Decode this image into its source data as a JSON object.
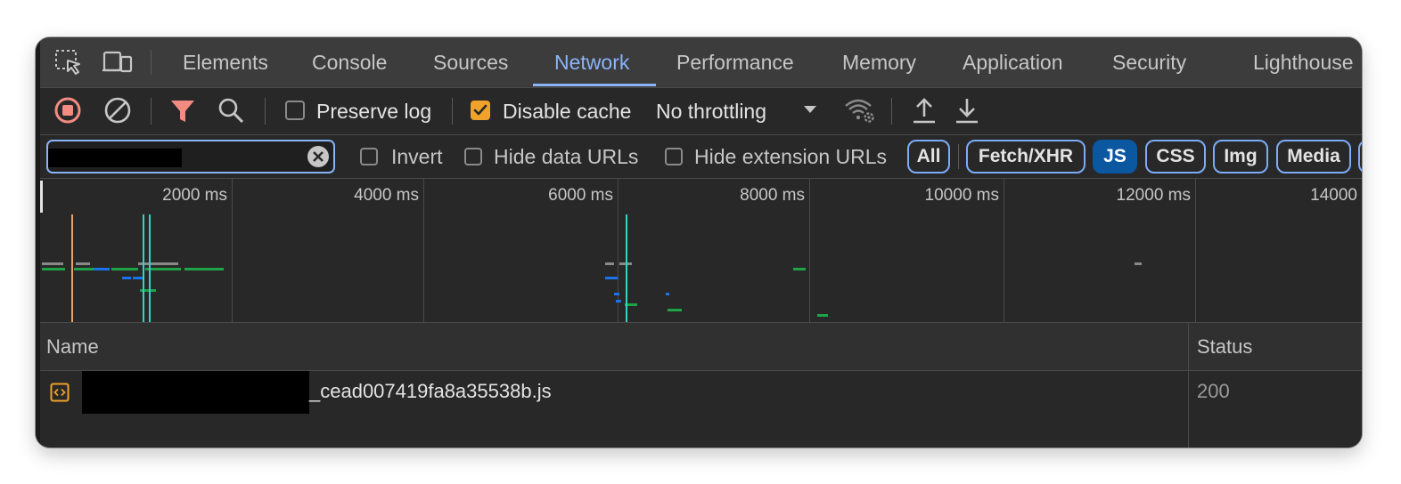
{
  "tabs": [
    {
      "label": "Elements",
      "active": false
    },
    {
      "label": "Console",
      "active": false
    },
    {
      "label": "Sources",
      "active": false
    },
    {
      "label": "Network",
      "active": true
    },
    {
      "label": "Performance",
      "active": false
    },
    {
      "label": "Memory",
      "active": false
    },
    {
      "label": "Application",
      "active": false
    },
    {
      "label": "Security",
      "active": false
    },
    {
      "label": "Lighthouse",
      "active": false
    }
  ],
  "toolbar": {
    "preserve_log": {
      "label": "Preserve log",
      "checked": false
    },
    "disable_cache": {
      "label": "Disable cache",
      "checked": true
    },
    "throttling": "No throttling"
  },
  "filter": {
    "value": "",
    "invert_label": "Invert",
    "hide_data_urls_label": "Hide data URLs",
    "hide_extension_urls_label": "Hide extension URLs",
    "chips": [
      {
        "label": "All",
        "active": false
      },
      {
        "label": "Fetch/XHR",
        "active": false
      },
      {
        "label": "JS",
        "active": true
      },
      {
        "label": "CSS",
        "active": false
      },
      {
        "label": "Img",
        "active": false
      },
      {
        "label": "Media",
        "active": false
      }
    ]
  },
  "overview": {
    "ticks": [
      "2000 ms",
      "4000 ms",
      "6000 ms",
      "8000 ms",
      "10000 ms",
      "12000 ms",
      "14000"
    ]
  },
  "table": {
    "headers": {
      "name": "Name",
      "status": "Status"
    },
    "rows": [
      {
        "name": "_cead007419fa8a35538b.js",
        "status": "200",
        "type": "script"
      }
    ]
  },
  "colors": {
    "accent": "#8ab4f8",
    "record_red": "#f28b82",
    "filter_red": "#f28b82",
    "checkbox_orange": "#f0a22a",
    "chip_active": "#0b57a0",
    "bar_green": "#1ea446",
    "bar_blue": "#1a73e8",
    "line_teal": "#34d3c4",
    "line_orange": "#f0a060"
  }
}
